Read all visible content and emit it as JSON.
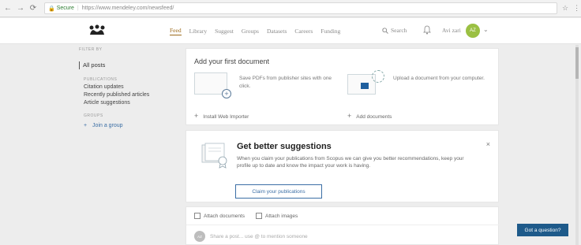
{
  "browser": {
    "back_icon": "arrow-left-icon",
    "forward_icon": "arrow-right-icon",
    "reload_icon": "reload-icon",
    "secure_label": "Secure",
    "url": "https://www.mendeley.com/newsfeed/"
  },
  "nav": {
    "items": [
      "Feed",
      "Library",
      "Suggest",
      "Groups",
      "Datasets",
      "Careers",
      "Funding"
    ],
    "active": "Feed",
    "search_label": "Search",
    "user_name": "Avi zari",
    "avatar_initials": "AZ"
  },
  "sidebar": {
    "filter_label": "FILTER BY",
    "all_posts": "All posts",
    "publications_label": "PUBLICATIONS",
    "items": [
      "Citation updates",
      "Recently published articles",
      "Article suggestions"
    ],
    "groups_label": "GROUPS",
    "join_group": "Join a group"
  },
  "card_add": {
    "title": "Add your first document",
    "save_text": "Save PDFs from publisher sites with one click.",
    "upload_text": "Upload a document from your computer.",
    "install_link": "Install Web Importer",
    "add_link": "Add documents"
  },
  "card_suggest": {
    "title": "Get better suggestions",
    "body": "When you claim your publications from Scopus we can give you better recommendations, keep your profile up to date and know the impact your work is having.",
    "button": "Claim your publications",
    "close_glyph": "×"
  },
  "card_post": {
    "attach_documents": "Attach documents",
    "attach_images": "Attach images",
    "placeholder": "Share a post... use @ to mention someone",
    "avatar_initials": "AZ"
  },
  "help_button": "Got a question?",
  "colors": {
    "active_nav": "#9c6a1a",
    "link_blue": "#3b6ea5",
    "help_bg": "#1e5a8a",
    "avatar_green": "#9bc043"
  }
}
